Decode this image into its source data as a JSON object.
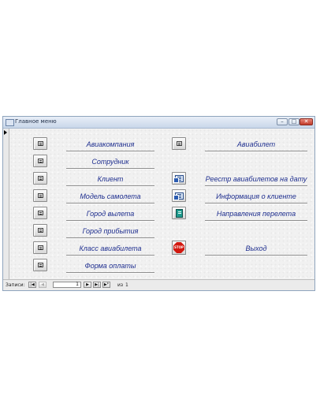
{
  "window": {
    "title": "Главное меню",
    "minimize_glyph": "–",
    "maximize_glyph": "□",
    "close_glyph": "✕"
  },
  "menu": {
    "left": [
      {
        "label": "Авиакомпания",
        "icon": "form-icon"
      },
      {
        "label": "Сотрудник",
        "icon": "form-icon"
      },
      {
        "label": "Клиент",
        "icon": "form-icon"
      },
      {
        "label": "Модель самолета",
        "icon": "form-icon"
      },
      {
        "label": "Город вылета",
        "icon": "form-icon"
      },
      {
        "label": "Город прибытия",
        "icon": "form-icon"
      },
      {
        "label": "Класс авиабилета",
        "icon": "form-icon"
      },
      {
        "label": "Форма оплаты",
        "icon": "form-icon"
      }
    ],
    "right": [
      {
        "label": "Авиабилет",
        "icon": "form-icon"
      },
      {
        "label": "Реестр авиабилетов на дату",
        "icon": "report-icon"
      },
      {
        "label": "Информация о клиенте",
        "icon": "report-icon"
      },
      {
        "label": "Направления перелета",
        "icon": "book-icon"
      },
      {
        "label": "Выход",
        "icon": "stop-icon",
        "icon_text": "STOP"
      }
    ]
  },
  "navigation": {
    "label": "Записи:",
    "first_glyph": "|◀",
    "prev_glyph": "◀",
    "current_record": "1",
    "next_glyph": "▶",
    "last_glyph": "▶|",
    "new_glyph": "▶*",
    "of_label": "из",
    "total_records": "1"
  },
  "colors": {
    "label_text": "#1f2f8f",
    "stop_red": "#d2180f",
    "close_button": "#c23b2a"
  }
}
